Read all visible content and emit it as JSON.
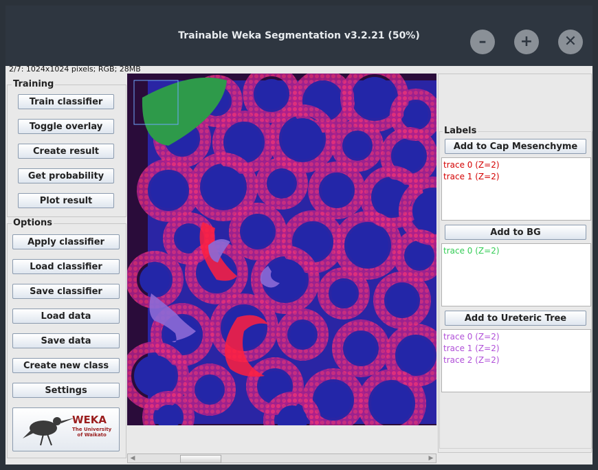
{
  "window": {
    "title": "Trainable Weka Segmentation v3.2.21 (50%)",
    "minimize": "–",
    "maximize": "+",
    "close": "✕"
  },
  "image_info": "2/7: 1024x1024 pixels; RGB; 28MB",
  "training": {
    "legend": "Training",
    "buttons": [
      "Train classifier",
      "Toggle overlay",
      "Create result",
      "Get probability",
      "Plot result"
    ]
  },
  "options": {
    "legend": "Options",
    "buttons": [
      "Apply classifier",
      "Load classifier",
      "Save classifier",
      "Load data",
      "Save data",
      "Create new class",
      "Settings"
    ]
  },
  "weka_logo": {
    "name": "WEKA",
    "subtitle1": "The University",
    "subtitle2": "of Waikato"
  },
  "labels": {
    "legend": "Labels",
    "classes": [
      {
        "button": "Add to Cap Mesenchyme",
        "color": "#d40000",
        "traces": [
          "trace 0 (Z=2)",
          "trace 1 (Z=2)"
        ]
      },
      {
        "button": "Add to BG",
        "color": "#33cc55",
        "traces": [
          "trace 0 (Z=2)"
        ]
      },
      {
        "button": "Add to Ureteric Tree",
        "color": "#b04fd8",
        "traces": [
          "trace 0 (Z=2)",
          "trace 1 (Z=2)",
          "trace 2 (Z=2)"
        ]
      }
    ]
  },
  "colors": {
    "background_overlay": "#2e9a4a",
    "cap_overlay": "#ff2040",
    "ureteric_overlay": "#8c6ad6"
  }
}
